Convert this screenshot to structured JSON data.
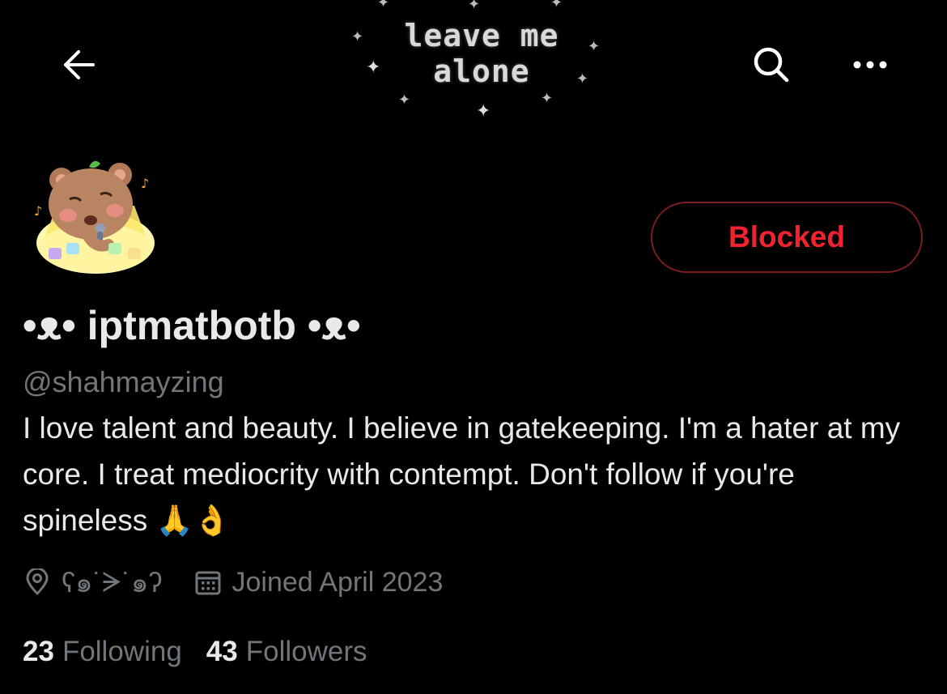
{
  "header": {
    "banner_line1": "leave me",
    "banner_line2": "alone"
  },
  "profile": {
    "action_button_label": "Blocked",
    "display_name": "•ᴥ• iptmatbotb •ᴥ•",
    "handle": "@shahmayzing",
    "bio": "I love talent and beauty. I believe in gatekeeping. I'm a hater at my core. I treat mediocrity with contempt. Don't follow if you're spineless 🙏👌",
    "location": "ʕ๑˙ᗒ˙๑ʔ",
    "joined": "Joined April 2023",
    "following_count": "23",
    "following_label": "Following",
    "followers_count": "43",
    "followers_label": "Followers"
  },
  "icons": {
    "back": "arrow-left-icon",
    "search": "search-icon",
    "more": "more-horizontal-icon",
    "location": "location-pin-icon",
    "calendar": "calendar-icon"
  },
  "colors": {
    "background": "#000000",
    "primary_text": "#e7e9ea",
    "secondary_text": "#71767b",
    "blocked_red": "#f4212e",
    "blocked_border": "#7a1d20"
  }
}
